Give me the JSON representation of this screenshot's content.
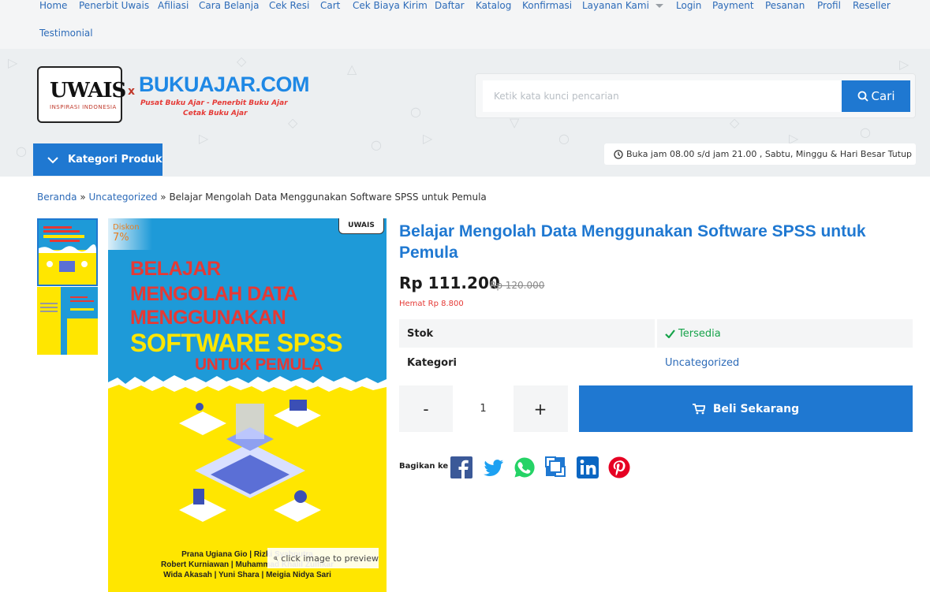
{
  "nav": {
    "items": [
      "Home",
      "Penerbit Uwais",
      "Afiliasi",
      "Cara Belanja",
      "Cek Resi",
      "Cart",
      "Cek Biaya Kirim",
      "Daftar",
      "Katalog",
      "Konfirmasi",
      "Layanan Kami",
      "Login",
      "Payment",
      "Pesanan",
      "Profil",
      "Reseller",
      "Testimonial"
    ]
  },
  "logo": {
    "uwais": "UWAIS",
    "uwais_sub": "INSPIRASI INDONESIA",
    "x": "x",
    "bukuajar": "BUKUAJAR.COM",
    "tagline_1": "Pusat Buku Ajar - Penerbit Buku Ajar",
    "tagline_2": "Cetak Buku Ajar"
  },
  "search": {
    "placeholder": "Ketik kata kunci pencarian",
    "button_label": "Cari"
  },
  "category_button": "Kategori Produk",
  "hours": "Buka jam 08.00 s/d jam 21.00 , Sabtu, Minggu & Hari Besar Tutup",
  "breadcrumb": {
    "home": "Beranda",
    "sep": "»",
    "category": "Uncategorized",
    "current": "Belajar Mengolah Data Menggunakan Software SPSS untuk Pemula"
  },
  "image": {
    "discount_label": "Diskon",
    "discount_value": "7%",
    "publisher_mark": "UWAIS",
    "cover_line_1": "BELAJAR",
    "cover_line_2": "MENGOLAH DATA",
    "cover_line_3": "MENGGUNAKAN",
    "cover_line_4": "SOFTWARE SPSS",
    "cover_line_5": "UNTUK PEMULA",
    "authors_1": "Prana Ugiana Gio | Rizki Syahputra",
    "authors_2": "Robert Kurniawan | Muhammad Khalil Zulfikar",
    "authors_3": "Wida Akasah | Yuni Shara | Meigia Nidya Sari",
    "preview_label": "click image to preview"
  },
  "product": {
    "title": "Belajar Mengolah Data Menggunakan Software SPSS untuk Pemula",
    "price": "Rp 111.200",
    "old_price": "Rp 120.000",
    "saving": "Hemat Rp 8.800",
    "stock_label": "Stok",
    "stock_value": "Tersedia",
    "category_label": "Kategori",
    "category_value": "Uncategorized",
    "qty_minus": "-",
    "qty_value": "1",
    "qty_plus": "+",
    "buy_label": "Beli Sekarang"
  },
  "share": {
    "label": "Bagikan ke"
  },
  "colors": {
    "accent": "#1f78d1",
    "link": "#2d6bb8",
    "sale": "#e53935",
    "stock": "#16a34a",
    "cover_yellow": "#ffe600",
    "cover_blue": "#1e9ad8",
    "cover_red": "#e53935"
  }
}
